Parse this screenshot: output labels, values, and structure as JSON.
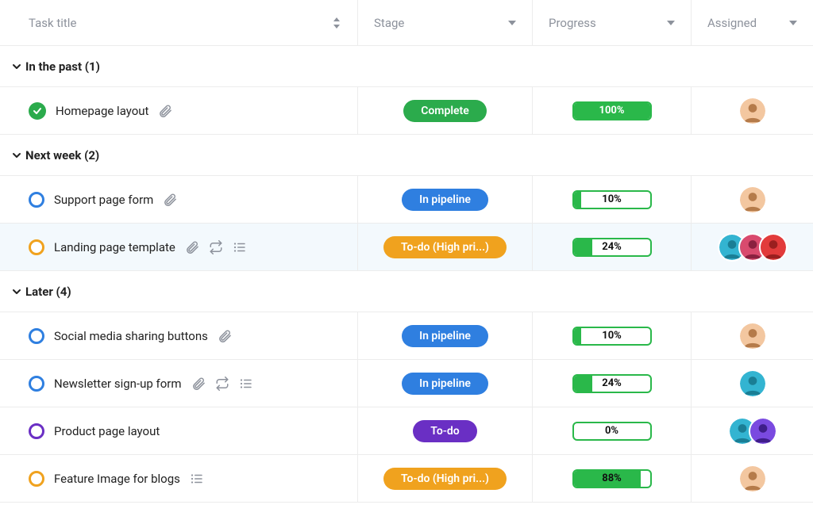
{
  "columns": {
    "title": "Task title",
    "stage": "Stage",
    "progress": "Progress",
    "assigned": "Assigned"
  },
  "stage_colors": {
    "complete": "#2bab4c",
    "in_pipeline": "#2f7fe0",
    "todo_high": "#f0a21e",
    "todo": "#6a2fc4"
  },
  "status_ring_colors": {
    "complete": "#2bab4c",
    "blue": "#2f7fe0",
    "orange": "#f0a21e",
    "purple": "#6a2fc4"
  },
  "avatar_palette": {
    "a1": {
      "bg": "#f3c7a0",
      "accent": "#b57b4a"
    },
    "a2": {
      "bg": "#33b4d1",
      "accent": "#1a7e95"
    },
    "a3": {
      "bg": "#d94a6e",
      "accent": "#8a2140"
    },
    "a4": {
      "bg": "#e23b3b",
      "accent": "#9a1f1f"
    },
    "a5": {
      "bg": "#7a4ae0",
      "accent": "#3f1e8a"
    }
  },
  "groups": [
    {
      "label": "In the past (1)",
      "tasks": [
        {
          "title": "Homepage layout",
          "status": "complete",
          "ring": "complete",
          "stage_label": "Complete",
          "stage_color": "complete",
          "progress": 100,
          "icons": [
            "attachment"
          ],
          "avatars": [
            "a1"
          ],
          "highlight": false
        }
      ]
    },
    {
      "label": "Next week (2)",
      "tasks": [
        {
          "title": "Support page form",
          "status": "open",
          "ring": "blue",
          "stage_label": "In pipeline",
          "stage_color": "in_pipeline",
          "progress": 10,
          "icons": [
            "attachment"
          ],
          "avatars": [
            "a1"
          ],
          "highlight": false
        },
        {
          "title": "Landing page template",
          "status": "open",
          "ring": "orange",
          "stage_label": "To-do (High pri...)",
          "stage_color": "todo_high",
          "progress": 24,
          "icons": [
            "attachment",
            "recur",
            "list"
          ],
          "avatars": [
            "a2",
            "a3",
            "a4"
          ],
          "highlight": true
        }
      ]
    },
    {
      "label": "Later (4)",
      "tasks": [
        {
          "title": "Social media sharing buttons",
          "status": "open",
          "ring": "blue",
          "stage_label": "In pipeline",
          "stage_color": "in_pipeline",
          "progress": 10,
          "icons": [
            "attachment"
          ],
          "avatars": [
            "a1"
          ],
          "highlight": false
        },
        {
          "title": "Newsletter sign-up form",
          "status": "open",
          "ring": "blue",
          "stage_label": "In pipeline",
          "stage_color": "in_pipeline",
          "progress": 24,
          "icons": [
            "attachment",
            "recur",
            "list"
          ],
          "avatars": [
            "a2"
          ],
          "highlight": false
        },
        {
          "title": "Product page layout",
          "status": "open",
          "ring": "purple",
          "stage_label": "To-do",
          "stage_color": "todo",
          "progress": 0,
          "icons": [],
          "avatars": [
            "a2",
            "a5"
          ],
          "highlight": false
        },
        {
          "title": "Feature Image for blogs",
          "status": "open",
          "ring": "orange",
          "stage_label": "To-do (High pri...)",
          "stage_color": "todo_high",
          "progress": 88,
          "icons": [
            "list"
          ],
          "avatars": [
            "a1"
          ],
          "highlight": false
        }
      ]
    }
  ]
}
